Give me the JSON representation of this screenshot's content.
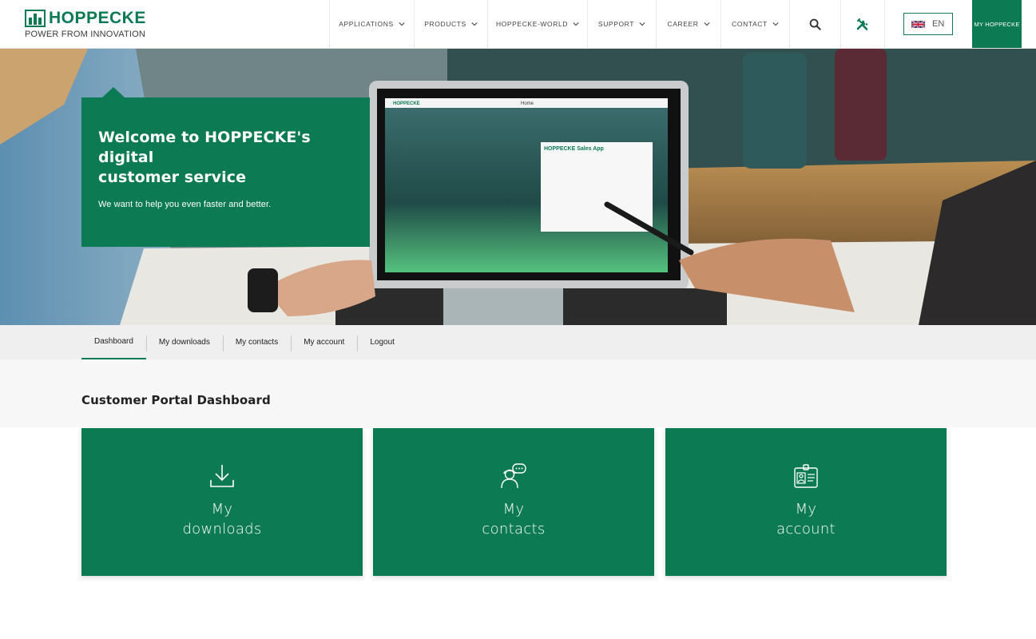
{
  "brand": {
    "name": "HOPPECKE",
    "tagline": "POWER FROM INNOVATION",
    "color": "#0c7a52"
  },
  "nav": {
    "items": [
      {
        "label": "APPLICATIONS"
      },
      {
        "label": "PRODUCTS"
      },
      {
        "label": "HOPPECKE-WORLD"
      },
      {
        "label": "SUPPORT"
      },
      {
        "label": "CAREER"
      },
      {
        "label": "CONTACT"
      }
    ],
    "search_icon": "search-icon",
    "tools_icon": "tools-icon",
    "language": "EN",
    "my_hoppecke": "MY HOPPECKE"
  },
  "hero": {
    "title_line1": "Welcome to HOPPECKE's digital",
    "title_line2": "customer service",
    "subtitle": "We want to help you even faster and better.",
    "screen_app_title": "HOPPECKE Sales App",
    "screen_home": "Home"
  },
  "subnav": {
    "items": [
      {
        "label": "Dashboard",
        "active": true
      },
      {
        "label": "My downloads"
      },
      {
        "label": "My contacts"
      },
      {
        "label": "My account"
      },
      {
        "label": "Logout"
      }
    ]
  },
  "dashboard": {
    "title": "Customer Portal Dashboard",
    "tiles": [
      {
        "line1": "My",
        "line2": "downloads",
        "icon": "download-icon"
      },
      {
        "line1": "My",
        "line2": "contacts",
        "icon": "contact-chat-icon"
      },
      {
        "line1": "My",
        "line2": "account",
        "icon": "id-card-icon"
      }
    ]
  }
}
